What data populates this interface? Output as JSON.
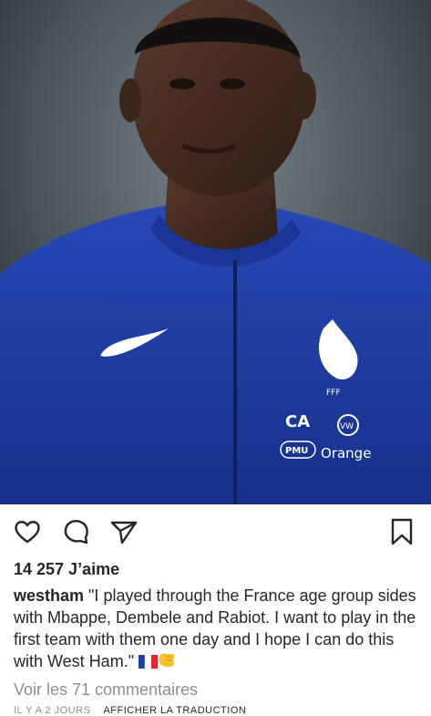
{
  "post": {
    "likes_text": "14 257 J’aime",
    "username": "westham",
    "caption_text": "\"I played through the France age group sides with Mbappe, Dembele and Rabiot. I want to play in the first team with them one day and I hope I can do this with West Ham.\"",
    "view_comments": "Voir les 71 commentaires",
    "time_ago": "IL Y A 2 JOURS",
    "translate_label": "AFFICHER LA TRADUCTION"
  },
  "jersey": {
    "badge_text": "FFF",
    "sponsor_ca": "CA",
    "sponsor_vw": "VW",
    "sponsor_pmu": "PMU",
    "sponsor_orange": "Orange"
  },
  "icons": {
    "like": "heart-icon",
    "comment": "comment-icon",
    "share": "send-icon",
    "save": "bookmark-icon"
  },
  "colors": {
    "jersey_blue": "#1f3fa8",
    "text": "#262626",
    "muted": "#8e8e8e"
  }
}
